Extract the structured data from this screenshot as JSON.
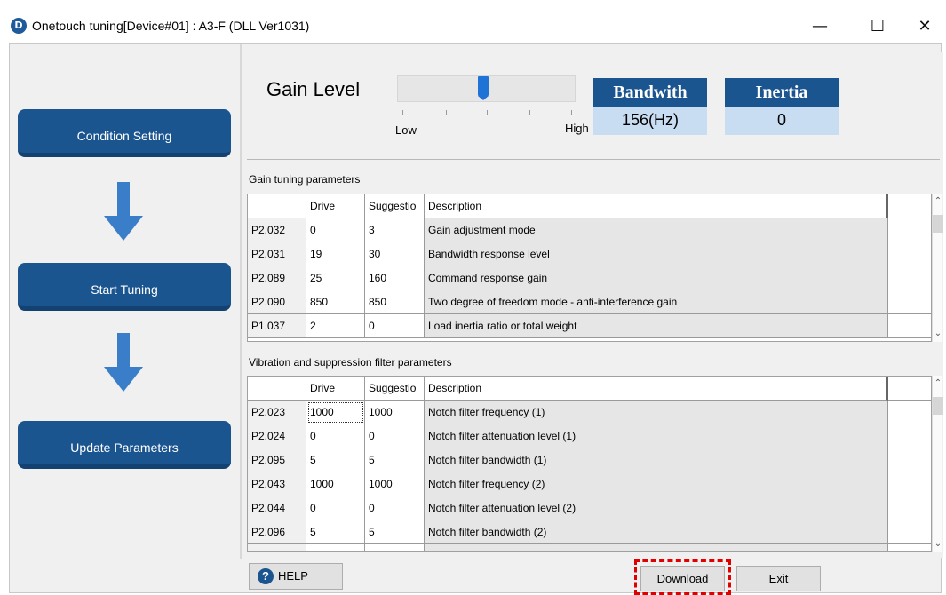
{
  "window": {
    "title": "Onetouch tuning[Device#01] : A3-F (DLL Ver1031)",
    "icon": "app-logo-icon",
    "controls": {
      "minimize": "—",
      "maximize": "☐",
      "close": "✕"
    }
  },
  "steps": [
    {
      "label": "Condition Setting"
    },
    {
      "label": "Start Tuning"
    },
    {
      "label": "Update Parameters"
    }
  ],
  "gain": {
    "label": "Gain Level",
    "low": "Low",
    "high": "High",
    "level_fraction": 0.48
  },
  "bandwidth": {
    "header": "Bandwith",
    "value": "156(Hz)"
  },
  "inertia": {
    "header": "Inertia",
    "value": "0"
  },
  "gain_table": {
    "title": "Gain tuning parameters",
    "columns": [
      "",
      "Drive",
      "Suggestio",
      "Description"
    ],
    "rows": [
      {
        "id": "P2.032",
        "drive": "0",
        "suggestion": "3",
        "description": "Gain adjustment mode"
      },
      {
        "id": "P2.031",
        "drive": "19",
        "suggestion": "30",
        "description": "Bandwidth response level"
      },
      {
        "id": "P2.089",
        "drive": "25",
        "suggestion": "160",
        "description": "Command response gain"
      },
      {
        "id": "P2.090",
        "drive": "850",
        "suggestion": "850",
        "description": "Two degree of freedom mode - anti-interference gain"
      },
      {
        "id": "P1.037",
        "drive": "2",
        "suggestion": "0",
        "description": "Load inertia ratio or total weight"
      }
    ]
  },
  "filter_table": {
    "title": "Vibration and suppression filter parameters",
    "columns": [
      "",
      "Drive",
      "Suggestio",
      "Description"
    ],
    "rows": [
      {
        "id": "P2.023",
        "drive": "1000",
        "suggestion": "1000",
        "description": "Notch filter frequency (1)"
      },
      {
        "id": "P2.024",
        "drive": "0",
        "suggestion": "0",
        "description": "Notch filter attenuation level (1)"
      },
      {
        "id": "P2.095",
        "drive": "5",
        "suggestion": "5",
        "description": "Notch filter bandwidth (1)"
      },
      {
        "id": "P2.043",
        "drive": "1000",
        "suggestion": "1000",
        "description": "Notch filter frequency (2)"
      },
      {
        "id": "P2.044",
        "drive": "0",
        "suggestion": "0",
        "description": "Notch filter attenuation level (2)"
      },
      {
        "id": "P2.096",
        "drive": "5",
        "suggestion": "5",
        "description": "Notch filter bandwidth (2)"
      }
    ]
  },
  "footer": {
    "help_label": "HELP",
    "download_label": "Download",
    "exit_label": "Exit"
  }
}
